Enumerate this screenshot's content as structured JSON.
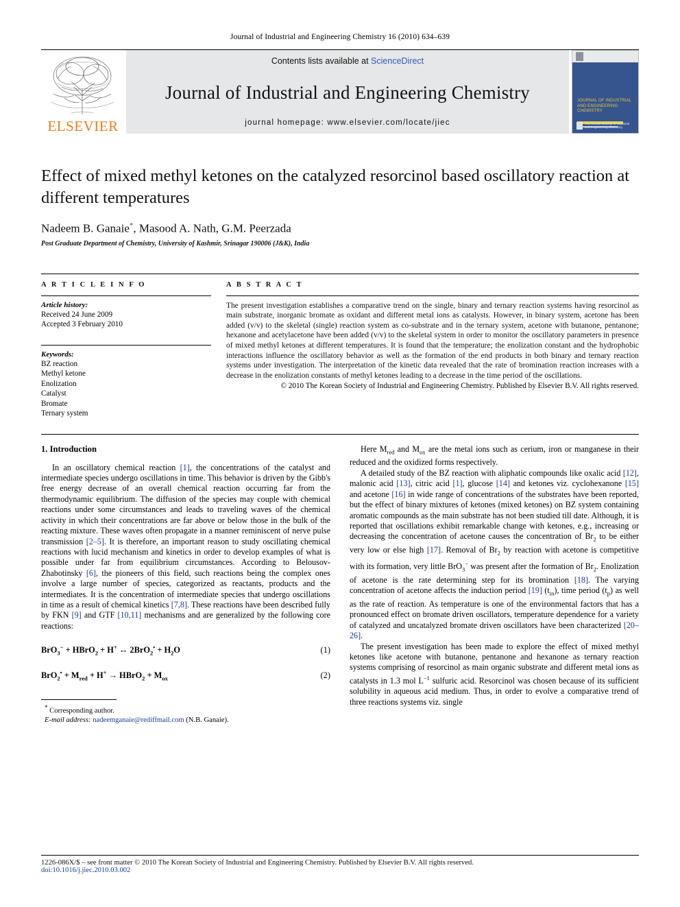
{
  "running_head": "Journal of Industrial and Engineering Chemistry 16 (2010) 634–639",
  "masthead": {
    "contents_prefix": "Contents lists available at ",
    "sciencedirect": "ScienceDirect",
    "journal_title": "Journal of Industrial and Engineering Chemistry",
    "homepage": "journal homepage: www.elsevier.com/locate/jiec",
    "publisher_wordmark": "ELSEVIER",
    "cover_title": "JOURNAL OF INDUSTRIAL AND ENGINEERING CHEMISTRY",
    "cover_footer": "The Korean Society of Industrial and Engineering Chemistry"
  },
  "title": "Effect of mixed methyl ketones on the catalyzed resorcinol based oscillatory reaction at different temperatures",
  "authors": "Nadeem B. Ganaie",
  "authors_rest": ", Masood A. Nath, G.M. Peerzada",
  "affiliation": "Post Graduate Department of Chemistry, University of Kashmir, Srinagar 190006 (J&K), India",
  "article_info": {
    "label": "A R T I C L E   I N F O",
    "history_head": "Article history:",
    "received": "Received 24 June 2009",
    "accepted": "Accepted 3 February 2010",
    "keywords_head": "Keywords:",
    "keywords": [
      "BZ reaction",
      "Methyl ketone",
      "Enolization",
      "Catalyst",
      "Bromate",
      "Ternary system"
    ]
  },
  "abstract": {
    "label": "A B S T R A C T",
    "text": "The present investigation establishes a comparative trend on the single, binary and ternary reaction systems having resorcinol as main substrate, inorganic bromate as oxidant and different metal ions as catalysts. However, in binary system, acetone has been added (v/v) to the skeletal (single) reaction system as co-substrate and in the ternary system, acetone with butanone, pentanone; hexanone and acetylacetone have been added (v/v) to the skeletal system in order to monitor the oscillatory parameters in presence of mixed methyl ketones at different temperatures. It is found that the temperature; the enolization constant and the hydrophobic interactions influence the oscillatory behavior as well as the formation of the end products in both binary and ternary reaction systems under investigation. The interpretation of the kinetic data revealed that the rate of bromination reaction increases with a decrease in the enolization constants of methyl ketones leading to a decrease in the time period of the oscillations.",
    "copyright": "© 2010 The Korean Society of Industrial and Engineering Chemistry. Published by Elsevier B.V. All rights reserved."
  },
  "section1": {
    "heading": "1. Introduction",
    "para1_a": "In an oscillatory chemical reaction ",
    "para1_ref1": "[1]",
    "para1_b": ", the concentrations of the catalyst and intermediate species undergo oscillations in time. This behavior is driven by the Gibb's free energy decrease of an overall chemical reaction occurring far from the thermodynamic equilibrium. The diffusion of the species may couple with chemical reactions under some circumstances and leads to traveling waves of the chemical activity in which their concentrations are far above or below those in the bulk of the reacting mixture. These waves often propagate in a manner reminiscent of nerve pulse transmission ",
    "para1_ref2": "[2–5]",
    "para1_c": ". It is therefore, an important reason to study oscillating chemical reactions with lucid mechanism and kinetics in order to develop examples of what is possible under far from equilibrium circumstances. According to Belousov-Zhabotinsky ",
    "para1_ref3": "[6]",
    "para1_d": ", the pioneers of this field, such reactions being the complex ones involve a large number of species, categorized as reactants, products and the intermediates. It is the concentration of intermediate species that undergo oscillations in time as a result of chemical kinetics ",
    "para1_ref4": "[7,8]",
    "para1_e": ". These reactions have been described fully by FKN ",
    "para1_ref5": "[9]",
    "para1_f": " and GTF ",
    "para1_ref6": "[10,11]",
    "para1_g": " mechanisms and are generalized by the following core reactions:"
  },
  "equations": [
    {
      "number": "(1)"
    },
    {
      "number": "(2)"
    }
  ],
  "footnote": {
    "corresponding": "Corresponding author.",
    "email_label": "E-mail address:",
    "email": "nadeemganaie@rediffmail.com",
    "email_suffix": "(N.B. Ganaie)."
  },
  "right_column": {
    "para_a1": "Here M",
    "para_a_sub1": "red",
    "para_a2": " and M",
    "para_a_sub2": "ox",
    "para_a3": " are the metal ions such as cerium, iron or manganese in their reduced and the oxidized forms respectively.",
    "para_b1": "A detailed study of the BZ reaction with aliphatic compounds like oxalic acid ",
    "para_b_r1": "[12]",
    "para_b2": ", malonic acid ",
    "para_b_r2": "[13]",
    "para_b3": ", citric acid ",
    "para_b_r3": "[1]",
    "para_b4": ", glucose ",
    "para_b_r4": "[14]",
    "para_b5": " and ketones viz. cyclohexanone ",
    "para_b_r5": "[15]",
    "para_b6": " and acetone ",
    "para_b_r6": "[16]",
    "para_b7": " in wide range of concentrations of the substrates have been reported, but the effect of binary mixtures of ketones (mixed ketones) on BZ system containing aromatic compounds as the main substrate has not been studied till date. Although, it is reported that oscillations exhibit remarkable change with ketones, e.g., increasing or decreasing the concentration of acetone causes the concentration of Br",
    "para_b_sub1": "2",
    "para_b8": " to be either very low or else high ",
    "para_b_r7": "[17]",
    "para_b9": ". Removal of Br",
    "para_b_sub2": "2",
    "para_b10": " by reaction with acetone is competitive with its formation, very little BrO",
    "para_b_sub3": "3",
    "para_b_sup1": "−",
    "para_b11": " was present after the formation of Br",
    "para_b_sub4": "2",
    "para_b12": ". Enolization of acetone is the rate determining step for its bromination ",
    "para_b_r8": "[18]",
    "para_b13": ". The varying concentration of acetone affects the induction period ",
    "para_b_r9": "[19]",
    "para_b14": " (t",
    "para_b_sub5": "in",
    "para_b15": "), time period (t",
    "para_b_sub6": "p",
    "para_b16": ") as well as the rate of reaction. As temperature is one of the environmental factors that has a pronounced effect on bromate driven oscillators, temperature dependence for a variety of catalyzed and uncatalyzed bromate driven oscillators have been characterized ",
    "para_b_r10": "[20–26]",
    "para_b17": ".",
    "para_c1": "The present investigation has been made to explore the effect of mixed methyl ketones like acetone with butanone, pentanone and hexanone as ternary reaction systems comprising of resorcinol as main organic substrate and different metal ions as catalysts in 1.3 mol L",
    "para_c_sup1": "−1",
    "para_c2": " sulfuric acid. Resorcinol was chosen because of its sufficient solubility in aqueous acid medium. Thus, in order to evolve a comparative trend of three reactions systems viz. single"
  },
  "page_footer": {
    "line1": "1226-086X/$ – see front matter © 2010 The Korean Society of Industrial and Engineering Chemistry. Published by Elsevier B.V. All rights reserved.",
    "line2": "doi:10.1016/j.jiec.2010.03.002"
  },
  "colors": {
    "link_blue": "#2b5bb5",
    "ref_blue": "#1a3a8f",
    "elsevier_orange": "#ef7d1a",
    "masthead_grey": "#e6e7e8",
    "cover_navy": "#36548e"
  }
}
